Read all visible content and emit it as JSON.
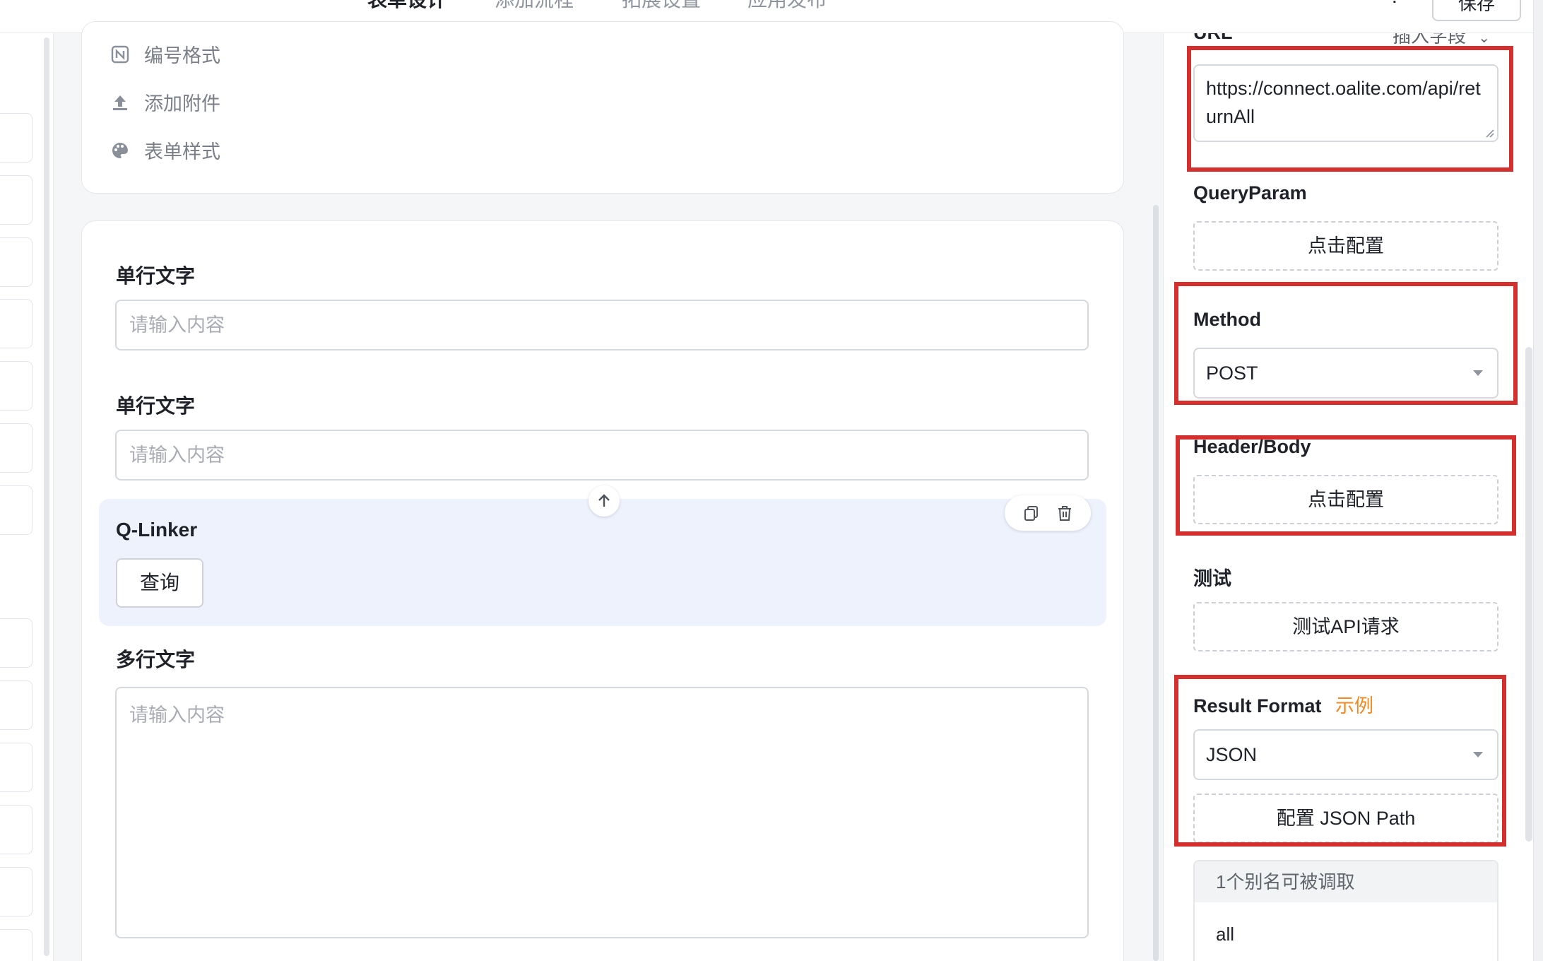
{
  "topbar": {
    "tabs": [
      "表单设计",
      "添加流程",
      "拓展设置",
      "应用发布"
    ],
    "help": "?",
    "save_label": "保存"
  },
  "form_settings": {
    "items": [
      {
        "icon": "number-format-icon",
        "label": "编号格式"
      },
      {
        "icon": "upload-icon",
        "label": "添加附件"
      },
      {
        "icon": "palette-icon",
        "label": "表单样式"
      }
    ]
  },
  "form": {
    "field1": {
      "label": "单行文字",
      "placeholder": "请输入内容"
    },
    "field2": {
      "label": "单行文字",
      "placeholder": "请输入内容"
    },
    "qlinker": {
      "label": "Q-Linker",
      "button": "查询"
    },
    "field3": {
      "label": "多行文字",
      "placeholder": "请输入内容"
    }
  },
  "panel": {
    "url_label": "URL",
    "insert_field": "插入字段",
    "url_value": "https://connect.oalite.com/api/returnAll",
    "query_label": "QueryParam",
    "query_button": "点击配置",
    "method_label": "Method",
    "method_value": "POST",
    "header_label": "Header/Body",
    "header_button": "点击配置",
    "test_label": "测试",
    "test_button": "测试API请求",
    "result_label": "Result Format",
    "result_example": "示例",
    "result_value": "JSON",
    "json_path_button": "配置 JSON Path",
    "alias_header": "1个别名可被调取",
    "alias_item": "all"
  },
  "colors": {
    "accent": "#f0a050",
    "highlight_box": "#d32f2f",
    "selected_bg": "#eef2fc"
  }
}
